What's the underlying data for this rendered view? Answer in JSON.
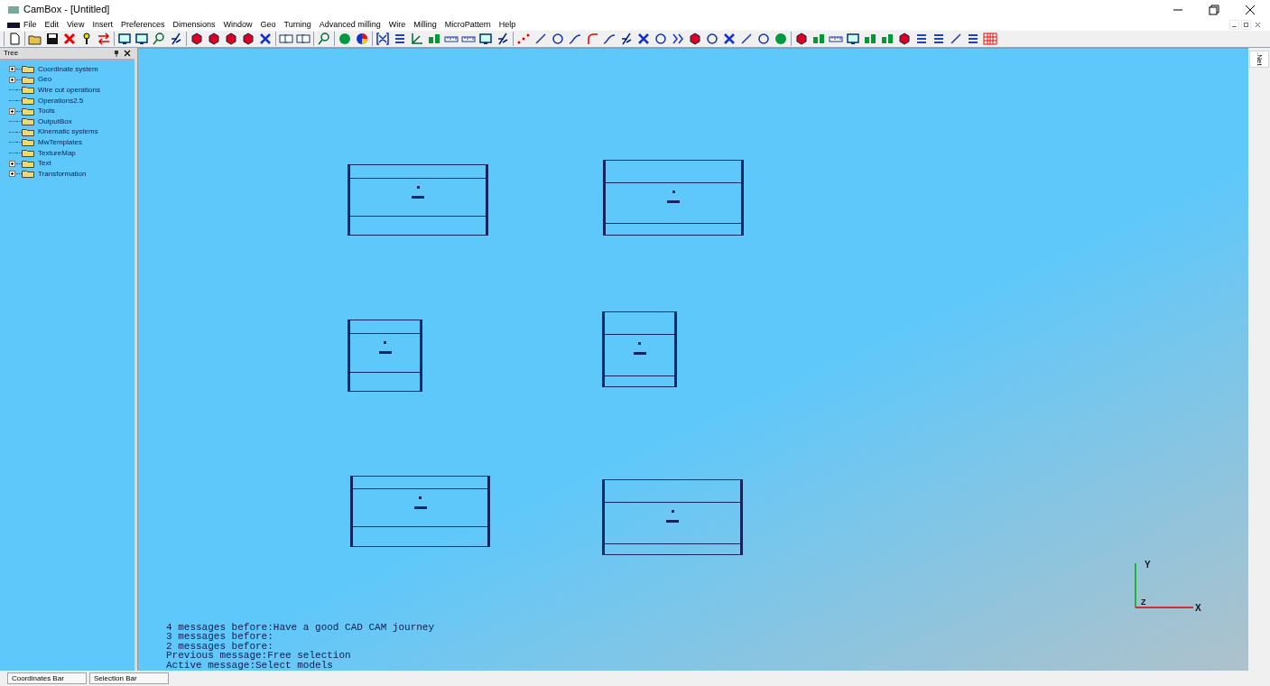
{
  "window": {
    "title": "CamBox - [Untitled]"
  },
  "menu": [
    "File",
    "Edit",
    "View",
    "Insert",
    "Preferences",
    "Dimensions",
    "Window",
    "Geo",
    "Turning",
    "Advanced milling",
    "Wire",
    "Milling",
    "MicroPattern",
    "Help"
  ],
  "toolbar": [
    [
      {
        "kind": "new"
      }
    ],
    [
      {
        "kind": "open"
      },
      {
        "kind": "save"
      },
      {
        "kind": "delete"
      },
      {
        "kind": "help"
      },
      {
        "kind": "swap"
      }
    ],
    [
      {
        "kind": "frame"
      },
      {
        "kind": "frame"
      },
      {
        "kind": "probe"
      },
      {
        "kind": "tool"
      }
    ],
    [
      {
        "kind": "cube"
      },
      {
        "kind": "cube"
      },
      {
        "kind": "cube"
      },
      {
        "kind": "cube"
      },
      {
        "kind": "cross"
      }
    ],
    [
      {
        "kind": "copy"
      },
      {
        "kind": "copy"
      }
    ],
    [
      {
        "kind": "probe"
      }
    ],
    [
      {
        "kind": "ball"
      },
      {
        "kind": "pie"
      }
    ],
    [
      {
        "kind": "bracket"
      },
      {
        "kind": "bars"
      },
      {
        "kind": "axes"
      },
      {
        "kind": "ab"
      },
      {
        "kind": "ruler"
      },
      {
        "kind": "ruler"
      },
      {
        "kind": "frame"
      },
      {
        "kind": "tool"
      }
    ],
    [
      {
        "kind": "dots"
      },
      {
        "kind": "line"
      },
      {
        "kind": "circle"
      },
      {
        "kind": "curve"
      },
      {
        "kind": "arc"
      },
      {
        "kind": "curve"
      },
      {
        "kind": "tool"
      },
      {
        "kind": "cross"
      },
      {
        "kind": "circle"
      },
      {
        "kind": "chev"
      },
      {
        "kind": "cube"
      },
      {
        "kind": "circle"
      },
      {
        "kind": "cross"
      },
      {
        "kind": "line"
      },
      {
        "kind": "circle"
      },
      {
        "kind": "ball"
      }
    ],
    [
      {
        "kind": "cube"
      },
      {
        "kind": "ab"
      },
      {
        "kind": "ruler"
      },
      {
        "kind": "frame"
      },
      {
        "kind": "ab"
      },
      {
        "kind": "ab"
      },
      {
        "kind": "cube"
      },
      {
        "kind": "bars"
      },
      {
        "kind": "bars"
      },
      {
        "kind": "line"
      },
      {
        "kind": "bars"
      },
      {
        "kind": "grid"
      }
    ]
  ],
  "tree": {
    "title": "Tree",
    "items": [
      {
        "label": "Coordinate system",
        "expandable": true
      },
      {
        "label": "Geo",
        "expandable": true
      },
      {
        "label": "Wire cut operations",
        "expandable": false
      },
      {
        "label": "Operations2.5",
        "expandable": false
      },
      {
        "label": "Tools",
        "expandable": true
      },
      {
        "label": "OutputBox",
        "expandable": false
      },
      {
        "label": "Kinematic systems",
        "expandable": false
      },
      {
        "label": "MwTemplates",
        "expandable": false
      },
      {
        "label": "TextureMap",
        "expandable": false
      },
      {
        "label": "Text",
        "expandable": true
      },
      {
        "label": "Transformation",
        "expandable": true
      }
    ]
  },
  "axes": {
    "y": "Y",
    "z": "Z",
    "x": "X"
  },
  "messages": [
    "4 messages before:Have a good CAD CAM journey",
    "3 messages before:",
    "2 messages before:",
    "Previous message:Free selection",
    "Active message:Select models"
  ],
  "side_tab": ".Net",
  "status_tabs": [
    "Coordinates Bar",
    "Selection Bar"
  ]
}
